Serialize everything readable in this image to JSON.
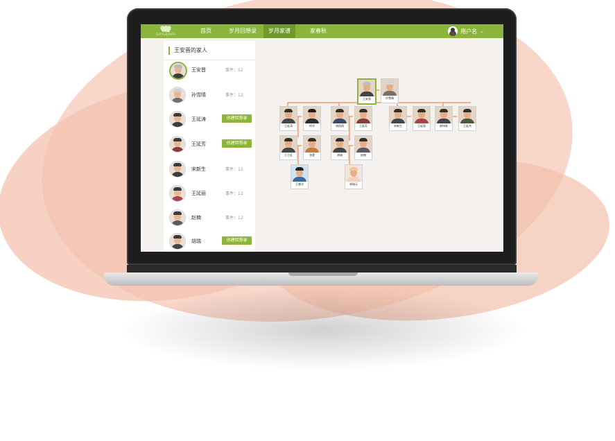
{
  "nav": {
    "logo_text": "SUIYUEJIAPU",
    "items": [
      "首页",
      "岁月回想录",
      "岁月家谱",
      "家春秋"
    ],
    "active_index": 2,
    "user_label": "用户名",
    "caret": "⌄"
  },
  "sidebar": {
    "title": "王安晋的家人",
    "members": [
      {
        "name": "王安晋",
        "count_text": "事件：52",
        "button": null,
        "selected": true
      },
      {
        "name": "孙雪晴",
        "count_text": "事件：12",
        "button": null
      },
      {
        "name": "王延涛",
        "count_text": null,
        "button": "创建回想录"
      },
      {
        "name": "王延芳",
        "count_text": null,
        "button": "创建回想录"
      },
      {
        "name": "宋新生",
        "count_text": "事件：12",
        "button": null
      },
      {
        "name": "王延丽",
        "count_text": "事件：12",
        "button": null
      },
      {
        "name": "赵楠",
        "count_text": "事件：12",
        "button": null
      },
      {
        "name": "胡瑞",
        "count_text": null,
        "button": "创建回想录"
      }
    ]
  },
  "tree": {
    "nodes": [
      "王安晋",
      "孙雪晴",
      "王延涛",
      "柯华",
      "胡凯翔",
      "王延芳",
      "宋新生",
      "王延丽",
      "郝伟联",
      "王延杰",
      "王王征",
      "张桑",
      "胡瑞",
      "赵楠",
      "王睿洋",
      "胡瑞元"
    ]
  },
  "colors": {
    "nav_green": "#8ab53a",
    "nav_active": "#6e9a27",
    "connector_orange": "#f08a4b",
    "button_green": "#8ab53a"
  },
  "icons": [
    "logo-icon",
    "user-avatar-icon",
    "chevron-down-icon"
  ]
}
